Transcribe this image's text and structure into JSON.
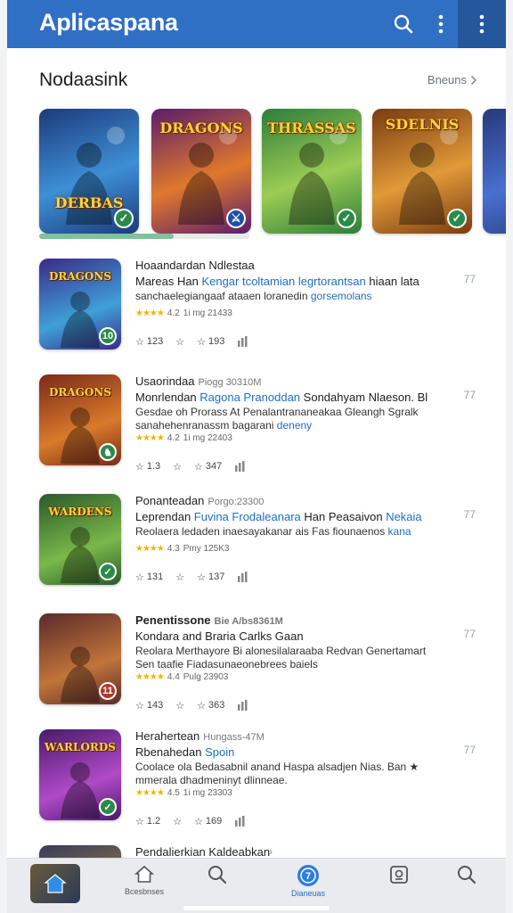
{
  "app_bar": {
    "title": "Aplicaspana",
    "search_icon": "search-icon",
    "more_icon": "more-vert-icon",
    "color": "#2f6fc4"
  },
  "featured": {
    "title": "Nodaasink",
    "see_all": "Bneuns",
    "tiles": [
      {
        "logo": "DERBAS",
        "badge": "check",
        "colors": [
          "#1c3b7a",
          "#3d8fd6"
        ],
        "badge_color": "#2a8a4a"
      },
      {
        "logo": "DRAGONS",
        "badge": "sword",
        "colors": [
          "#5a1d6b",
          "#e0782c"
        ],
        "badge_color": "#1f4fa8"
      },
      {
        "logo": "THRASSAS",
        "badge": "check",
        "colors": [
          "#2e7d3a",
          "#9ccc55"
        ],
        "badge_color": "#2a8a4a"
      },
      {
        "logo": "SDELNIS",
        "badge": "check",
        "colors": [
          "#7a3b12",
          "#e09a38"
        ],
        "badge_color": "#2a8a4a"
      },
      {
        "logo": "",
        "badge": "",
        "colors": [
          "#263a7a",
          "#4a6fd0"
        ],
        "badge_color": "#2a8a4a"
      }
    ],
    "scroll_progress": 0.64
  },
  "list": [
    {
      "name": "Hoaandardan Ndlestaa",
      "meta": "",
      "line2_a": "Mareas Han",
      "line2_b": "Kengar tcoltamian legrtorantsan",
      "line2_c": "hiaan lata",
      "line3_a": "sanchaelegiangaaf ataaen loranedin",
      "line3_b": "gorsemolans",
      "rating": "4.2",
      "rating_text": "1i mg 21433",
      "downloads": "123",
      "reviews": "193",
      "side": "77",
      "logo": "DRAGONS",
      "colors": [
        "#3a2a8a",
        "#3fa0d8"
      ],
      "badge": "10",
      "badge_color": "#2a8a4a"
    },
    {
      "name": "Usaorindaa",
      "meta": "Piogg 30310M",
      "line2_a": "Monrlendan",
      "line2_b": "Ragona Pranoddan",
      "line2_c": "Sondahyam Nlaeson. Bl",
      "line3_a": "Gesdae oh Prorass At Penalantrananeakaa Gleangh Sgralk",
      "line3_b": "",
      "line4_a": "sanahehenranassm bagarani",
      "line4_b": "deneny",
      "rating": "4.2",
      "rating_text": "1i mg 22403",
      "downloads": "1.3",
      "reviews": "347",
      "side": "77",
      "logo": "DRAGONS",
      "colors": [
        "#7a2a1a",
        "#d97a2a"
      ],
      "badge": "♞",
      "badge_color": "#2a8a4a"
    },
    {
      "name": "Ponanteadan",
      "meta": "Porgo:23300",
      "line2_a": "Leprendan",
      "line2_b": "Fuvina Frodaleanara",
      "line2_c": "Han Peasaivon",
      "line2_d": "Nekaia",
      "line3_a": "Reolaera ledaden inaesayakanar ais Fas fiounaenos",
      "line3_b": "kana",
      "rating": "4.3",
      "rating_text": "Pmy 125K3",
      "downloads": "131",
      "reviews": "137",
      "side": "77",
      "logo": "WARDENS",
      "colors": [
        "#2a5a2a",
        "#7ab84a"
      ],
      "badge": "✓",
      "badge_color": "#2a8a4a"
    },
    {
      "name": "Penentissone",
      "meta": "Bie A/bs8361M",
      "line2_a": "Kondara and Braria Carlks Gaan",
      "line2_b": "",
      "line2_c": "",
      "line3_a": "Reolara Merthayore Bi alonesilalaraaba Redvan Genertamart",
      "line3_b": "",
      "line4_a": "Sen taafie Fiadasunaeonebrees baiels",
      "line4_b": "",
      "rating": "4.4",
      "rating_text": "Pulg 23903",
      "downloads": "143",
      "reviews": "363",
      "side": "77",
      "logo": "",
      "colors": [
        "#5a2a2a",
        "#c2743a"
      ],
      "badge": "11",
      "badge_color": "#b03a2a"
    },
    {
      "name": "Herahertean",
      "meta": "Hungass-47M",
      "line2_a": "Rbenahedan",
      "line2_b": "Spoin",
      "line2_c": "",
      "line3_a": "Coolace ola Bedasabnil anand Haspa alsadjen Nias. Ban ★",
      "line3_b": "",
      "line4_a": "mmerala dhadmeninyt dlinneae.",
      "line4_b": "",
      "rating": "4.5",
      "rating_text": "1i mg 23303",
      "downloads": "1.2",
      "reviews": "169",
      "side": "77",
      "logo": "WARLORDS",
      "colors": [
        "#4a1a6a",
        "#b04ac8"
      ],
      "badge": "✓",
      "badge_color": "#2a8a4a"
    },
    {
      "name": "Pendalierkian Kaldeabkan",
      "meta": "",
      "line2_a": "",
      "line2_b": "",
      "line2_c": "",
      "line3_a": "",
      "line3_b": "",
      "rating": "",
      "rating_text": "",
      "downloads": "",
      "reviews": "",
      "side": "",
      "logo": "",
      "colors": [
        "#3a3a5a",
        "#8a7a4a"
      ],
      "badge": "",
      "badge_color": "#2a8a4a"
    }
  ],
  "bottom_nav": [
    {
      "label": "",
      "icon": "home-filled-icon",
      "active": true
    },
    {
      "label": "Bcesbnses",
      "icon": "home-icon",
      "active": false
    },
    {
      "label": "",
      "icon": "search-icon",
      "active": false
    },
    {
      "label": "Dianeuas",
      "icon": "apps-icon",
      "active": true
    },
    {
      "label": "",
      "icon": "library-icon",
      "active": false
    },
    {
      "label": "",
      "icon": "search-icon",
      "active": false
    }
  ]
}
